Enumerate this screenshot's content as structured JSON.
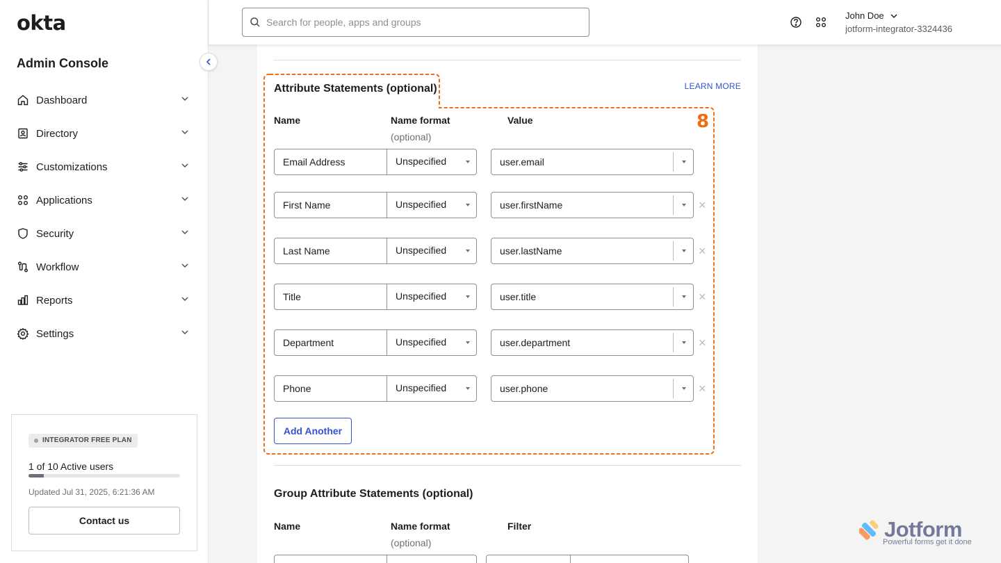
{
  "sidebar": {
    "logo": "okta",
    "console_title": "Admin Console",
    "items": [
      {
        "label": "Dashboard",
        "icon": "home-icon"
      },
      {
        "label": "Directory",
        "icon": "directory-icon"
      },
      {
        "label": "Customizations",
        "icon": "sliders-icon"
      },
      {
        "label": "Applications",
        "icon": "grid-icon"
      },
      {
        "label": "Security",
        "icon": "shield-icon"
      },
      {
        "label": "Workflow",
        "icon": "workflow-icon"
      },
      {
        "label": "Reports",
        "icon": "chart-icon"
      },
      {
        "label": "Settings",
        "icon": "gear-icon"
      }
    ],
    "plan": {
      "badge": "INTEGRATOR FREE PLAN",
      "users": "1 of 10 Active users",
      "usage_fraction": 0.1,
      "updated": "Updated Jul 31, 2025, 6:21:36 AM",
      "contact": "Contact us"
    }
  },
  "header": {
    "search_placeholder": "Search for people, apps and groups",
    "user_name": "John Doe",
    "user_org": "jotform-integrator-3324436"
  },
  "attributes": {
    "title": "Attribute Statements (optional)",
    "learn_more": "LEARN MORE",
    "col_name": "Name",
    "col_format": "Name format",
    "col_format_sub": "(optional)",
    "col_value": "Value",
    "rows": [
      {
        "name": "Email Address",
        "format": "Unspecified",
        "value": "user.email"
      },
      {
        "name": "First Name",
        "format": "Unspecified",
        "value": "user.firstName"
      },
      {
        "name": "Last Name",
        "format": "Unspecified",
        "value": "user.lastName"
      },
      {
        "name": "Title",
        "format": "Unspecified",
        "value": "user.title"
      },
      {
        "name": "Department",
        "format": "Unspecified",
        "value": "user.department"
      },
      {
        "name": "Phone",
        "format": "Unspecified",
        "value": "user.phone"
      }
    ],
    "remove_symbol": "×",
    "add_another": "Add Another",
    "annotation_number": "8"
  },
  "group_attributes": {
    "title": "Group Attribute Statements (optional)",
    "col_name": "Name",
    "col_format": "Name format",
    "col_format_sub": "(optional)",
    "col_filter": "Filter"
  },
  "watermark": {
    "brand": "Jotform",
    "tagline": "Powerful forms get it done"
  },
  "colors": {
    "accent": "#3451d1",
    "annotation": "#f26b0f"
  }
}
